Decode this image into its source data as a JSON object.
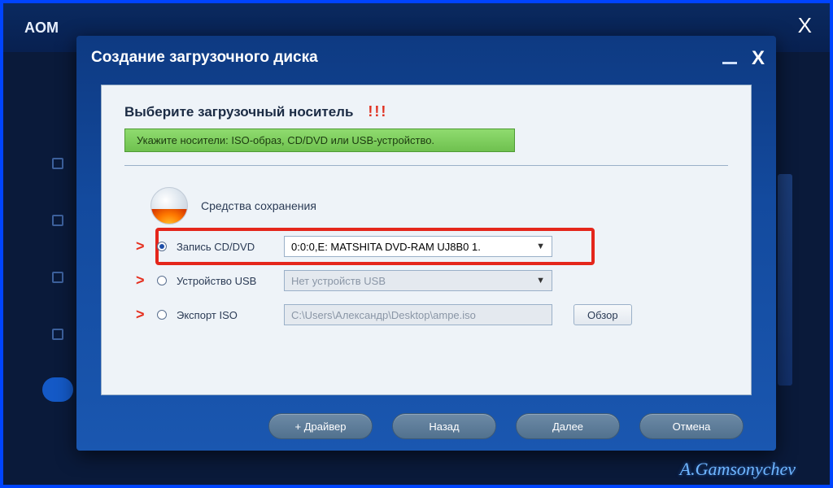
{
  "outer": {
    "title": "AOM",
    "close_glyph": "X"
  },
  "dialog": {
    "title": "Создание загрузочного диска",
    "close_glyph": "X"
  },
  "panel": {
    "subtitle": "Выберите загрузочный носитель",
    "bang": "!!!",
    "hint": "Укажите носители: ISO-образ, CD/DVD или USB-устройство.",
    "means_label": "Средства сохранения"
  },
  "options": {
    "cd": {
      "label": "Запись CD/DVD",
      "value": "0:0:0,E: MATSHITA DVD-RAM UJ8B0    1."
    },
    "usb": {
      "label": "Устройство USB",
      "value": "Нет устройств USB"
    },
    "iso": {
      "label": "Экспорт ISO",
      "value": "C:\\Users\\Александр\\Desktop\\ampe.iso",
      "browse": "Обзор"
    }
  },
  "arrow": ">",
  "footer": {
    "driver": "+ Драйвер",
    "back": "Назад",
    "next": "Далее",
    "cancel": "Отмена"
  },
  "watermark": "A.Gamsonychev"
}
